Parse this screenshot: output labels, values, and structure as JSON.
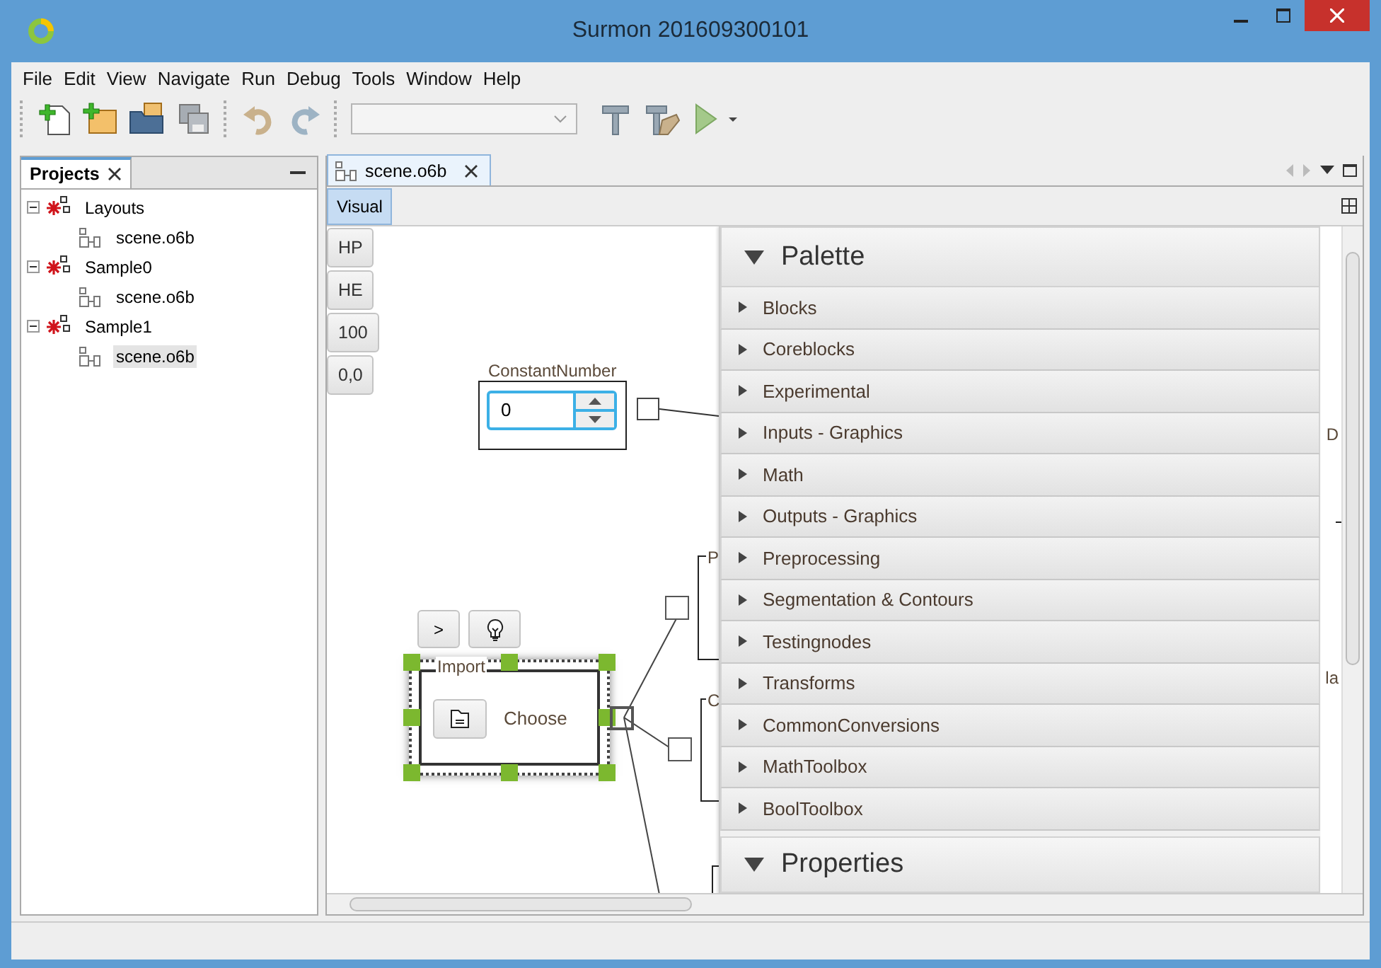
{
  "window": {
    "title": "Surmon 201609300101"
  },
  "menu": [
    "File",
    "Edit",
    "View",
    "Navigate",
    "Run",
    "Debug",
    "Tools",
    "Window",
    "Help"
  ],
  "projects_panel": {
    "title": "Projects",
    "tree": [
      {
        "label": "Layouts",
        "expanded": true,
        "selected": false,
        "children": [
          {
            "label": "scene.o6b",
            "selected": false
          }
        ]
      },
      {
        "label": "Sample0",
        "expanded": true,
        "selected": false,
        "children": [
          {
            "label": "scene.o6b",
            "selected": false
          }
        ]
      },
      {
        "label": "Sample1",
        "expanded": true,
        "selected": false,
        "children": [
          {
            "label": "scene.o6b",
            "selected": true
          }
        ]
      }
    ]
  },
  "editor": {
    "tab": "scene.o6b",
    "view_tabs": [
      {
        "label": "Visual",
        "selected": true
      }
    ],
    "side_buttons": [
      "HP",
      "HE",
      "100",
      "0,0"
    ],
    "canvas": {
      "constant_node": {
        "title": "ConstantNumber",
        "value": "0"
      },
      "node_toolbar": [
        {
          "kind": "text",
          "label": ">"
        },
        {
          "kind": "bulb"
        }
      ],
      "import_node": {
        "title": "Import",
        "button": "Choose",
        "selected": true
      },
      "cut_labels": [
        "P",
        "C",
        "D",
        "la"
      ]
    },
    "palette": {
      "title": "Palette",
      "expanded": true,
      "categories": [
        {
          "label": "Blocks",
          "expanded": false
        },
        {
          "label": "Coreblocks",
          "expanded": false
        },
        {
          "label": "Experimental",
          "expanded": false
        },
        {
          "label": "Inputs - Graphics",
          "expanded": false
        },
        {
          "label": "Math",
          "expanded": false
        },
        {
          "label": "Outputs - Graphics",
          "expanded": false
        },
        {
          "label": "Preprocessing",
          "expanded": false
        },
        {
          "label": "Segmentation & Contours",
          "expanded": false
        },
        {
          "label": "Testingnodes",
          "expanded": false
        },
        {
          "label": "Transforms",
          "expanded": false
        },
        {
          "label": "CommonConversions",
          "expanded": false
        },
        {
          "label": "MathToolbox",
          "expanded": false
        },
        {
          "label": "BoolToolbox",
          "expanded": false
        }
      ]
    },
    "properties": {
      "title": "Properties",
      "expanded": true
    }
  }
}
